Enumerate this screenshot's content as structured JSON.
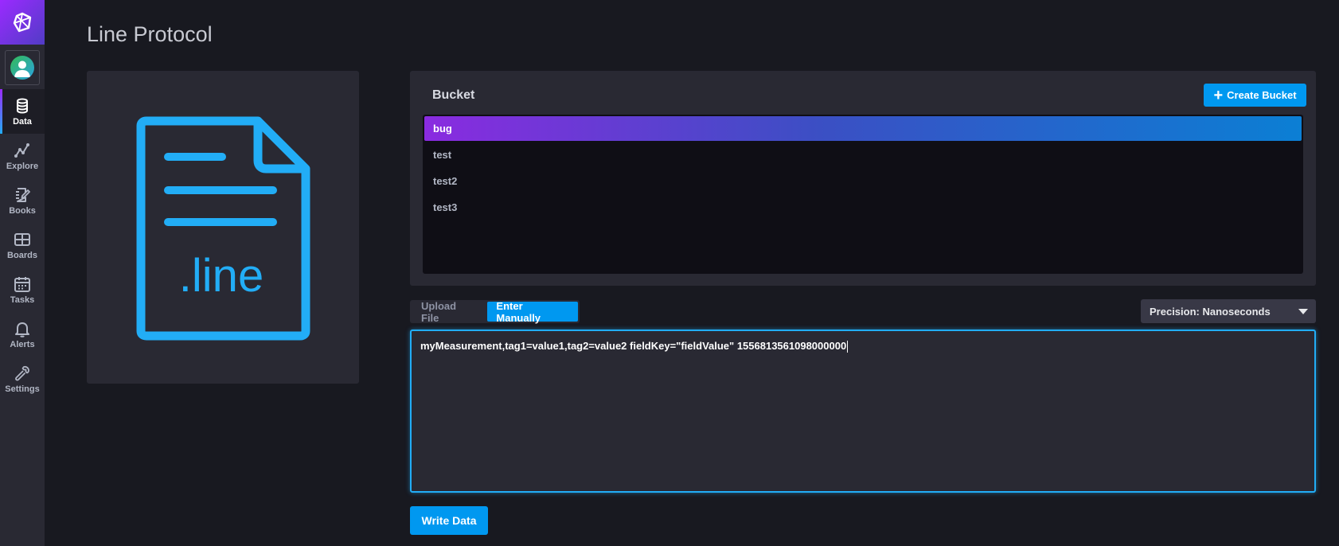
{
  "page": {
    "title": "Line Protocol"
  },
  "sidebar": {
    "logo": "influx-logo-icon",
    "avatar": "user-avatar-icon",
    "items": [
      {
        "label": "Data",
        "icon": "database-icon",
        "active": true
      },
      {
        "label": "Explore",
        "icon": "graph-line-icon",
        "active": false
      },
      {
        "label": "Books",
        "icon": "notebook-icon",
        "active": false
      },
      {
        "label": "Boards",
        "icon": "dashboards-icon",
        "active": false
      },
      {
        "label": "Tasks",
        "icon": "calendar-icon",
        "active": false
      },
      {
        "label": "Alerts",
        "icon": "bell-icon",
        "active": false
      },
      {
        "label": "Settings",
        "icon": "wrench-icon",
        "active": false
      }
    ]
  },
  "file_card": {
    "extension": ".line",
    "icon": "document-icon"
  },
  "bucket": {
    "title": "Bucket",
    "create_label": "Create Bucket",
    "items": [
      "bug",
      "test",
      "test2",
      "test3"
    ],
    "selected": "bug"
  },
  "upload": {
    "upload_file_label": "Upload File",
    "enter_manually_label": "Enter Manually",
    "active": "Enter Manually"
  },
  "precision": {
    "label": "Precision: Nanoseconds"
  },
  "editor": {
    "value": "myMeasurement,tag1=value1,tag2=value2 fieldKey=\"fieldValue\" 1556813561098000000"
  },
  "actions": {
    "write_label": "Write Data"
  },
  "colors": {
    "accent": "#0098f0",
    "focus": "#22adf6",
    "brand_purple": "#9b2aff",
    "background": "#181920",
    "panel": "#292933"
  }
}
